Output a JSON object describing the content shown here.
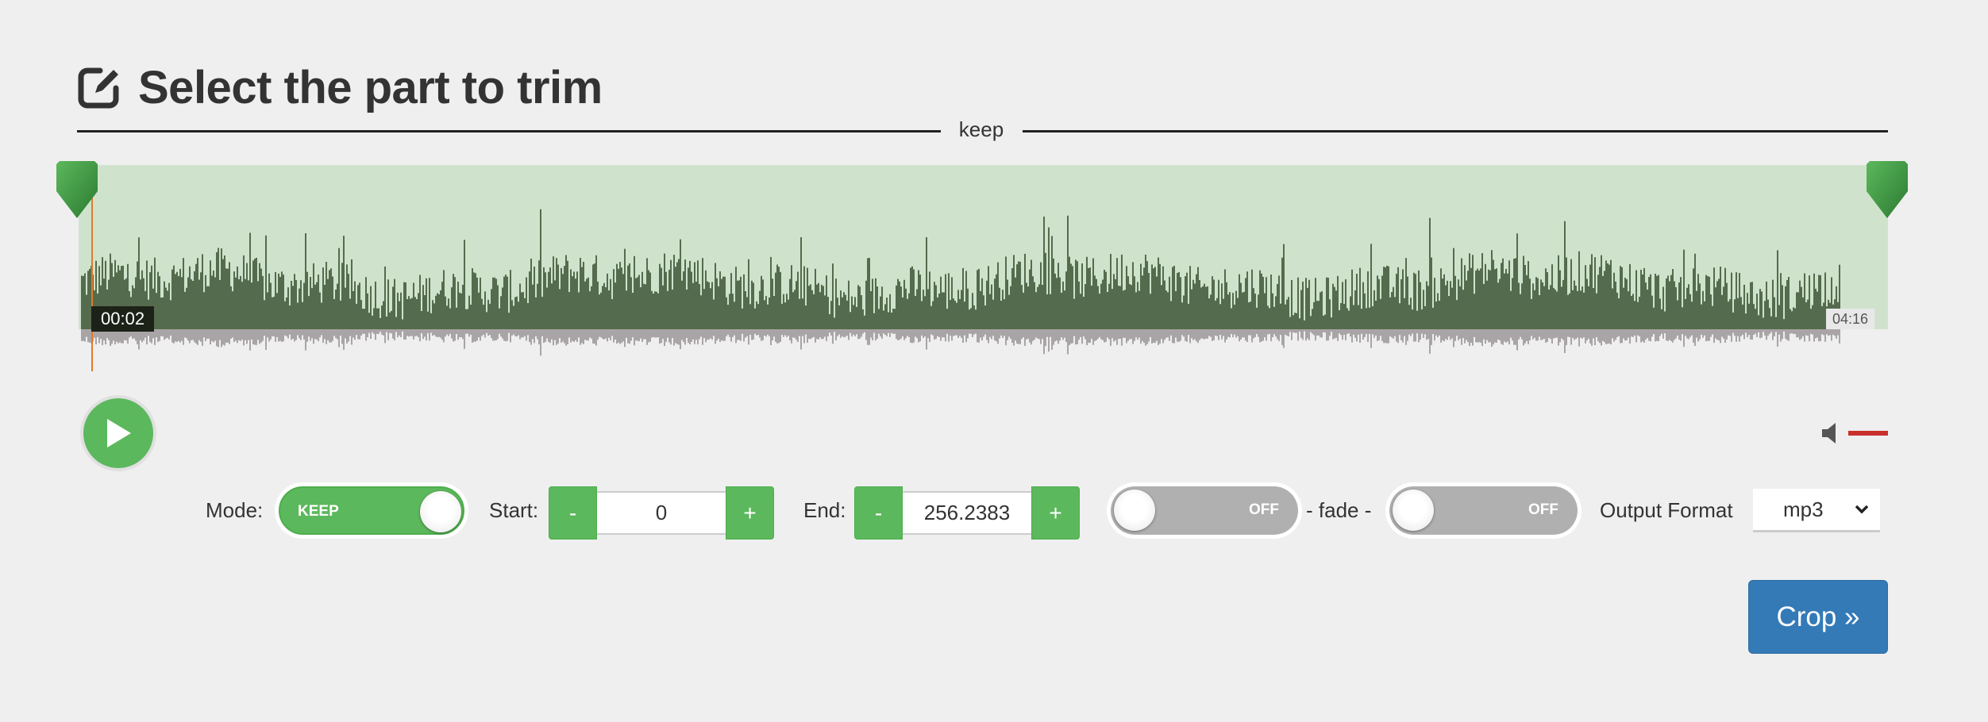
{
  "header": {
    "title": "Select the part to trim",
    "icon": "edit-icon"
  },
  "region_label": "keep",
  "waveform": {
    "current_time": "00:02",
    "duration": "04:16",
    "colors": {
      "selection": "#cfe3cc",
      "wave": "#556b4d",
      "wave_mirror": "#a9a5a6",
      "cursor": "#e07b2a",
      "handle": "#3f9b45"
    }
  },
  "player": {
    "play_icon": "play-icon",
    "volume_icon": "speaker-icon",
    "volume_color": "#c9302c"
  },
  "controls": {
    "mode_label": "Mode:",
    "mode_value": "KEEP",
    "start_label": "Start:",
    "start_value": "0",
    "end_label": "End:",
    "end_value": "256.2383",
    "minus": "-",
    "plus": "+",
    "fade_in": "OFF",
    "fade_label": "- fade -",
    "fade_out": "OFF",
    "format_label": "Output Format",
    "format_value": "mp3"
  },
  "crop_button": "Crop »",
  "colors": {
    "accent": "#5cb85c",
    "primary": "#337ab7"
  }
}
